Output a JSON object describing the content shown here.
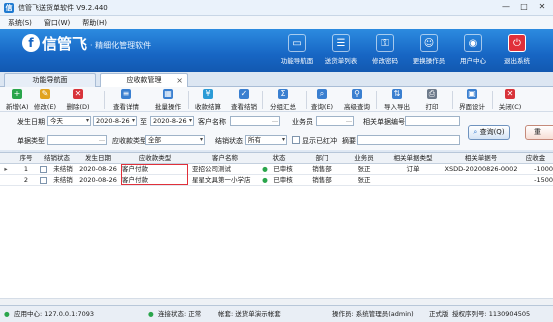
{
  "window": {
    "title": "信管飞送货单软件 V9.2.440",
    "min": "—",
    "max": "□",
    "close": "✕"
  },
  "menu": [
    {
      "label": "系统(S)"
    },
    {
      "label": "窗口(W)"
    },
    {
      "label": "帮助(H)"
    }
  ],
  "brand": {
    "logo_glyph": "f",
    "name": "信管飞",
    "slogan": "· 精细化管理软件"
  },
  "nav": [
    {
      "label": "功能导航面",
      "icon": "monitor-icon"
    },
    {
      "label": "送货单列表",
      "icon": "list-icon"
    },
    {
      "label": "修改密码",
      "icon": "key-icon"
    },
    {
      "label": "更换操作员",
      "icon": "user-icon"
    },
    {
      "label": "用户中心",
      "icon": "user-center-icon"
    },
    {
      "label": "退出系统",
      "icon": "power-icon"
    }
  ],
  "tabs": [
    {
      "label": "功能导航面"
    },
    {
      "label": "应收款管理",
      "close": "×"
    }
  ],
  "toolbar": [
    {
      "label": "新增(A)",
      "icon": "add-icon",
      "color": "#2aa54b",
      "glyph": "+"
    },
    {
      "label": "修改(E)",
      "icon": "edit-icon",
      "color": "#e1a320",
      "glyph": "✎"
    },
    {
      "label": "删除(D)",
      "icon": "delete-icon",
      "color": "#d8333a",
      "glyph": "✕"
    },
    {
      "label": "查看详情",
      "icon": "view-icon",
      "color": "#3a7fd0",
      "glyph": "≡"
    },
    {
      "label": "批量操作",
      "icon": "batch-icon",
      "color": "#3a7fd0",
      "glyph": "▦"
    },
    {
      "label": "收款结算",
      "icon": "settle-icon",
      "color": "#2b9bd6",
      "glyph": "¥"
    },
    {
      "label": "查看结销",
      "icon": "verify-icon",
      "color": "#3a7fd0",
      "glyph": "✓"
    },
    {
      "label": "分组汇总",
      "icon": "group-icon",
      "color": "#3a7fd0",
      "glyph": "Σ"
    },
    {
      "label": "查询(E)",
      "icon": "query-icon",
      "color": "#3a7fd0",
      "glyph": "⌕"
    },
    {
      "label": "高级查询",
      "icon": "advanced-query-icon",
      "color": "#3a7fd0",
      "glyph": "⚲"
    },
    {
      "label": "导入导出",
      "icon": "import-export-icon",
      "color": "#3a7fd0",
      "glyph": "⇅"
    },
    {
      "label": "打印",
      "icon": "print-icon",
      "color": "#6d7a8a",
      "glyph": "⎙"
    },
    {
      "label": "界面设计",
      "icon": "design-icon",
      "color": "#3a7fd0",
      "glyph": "▣"
    },
    {
      "label": "关闭(C)",
      "icon": "close-icon",
      "color": "#d8333a",
      "glyph": "✕"
    }
  ],
  "filters": {
    "date_label": "发生日期",
    "date_range": "今天",
    "date_from": "2020-8-26",
    "to": "至",
    "date_to": "2020-8-26",
    "customer_label": "客户名称",
    "clerk_label": "业务员",
    "related_label": "相关单据编号",
    "type_label": "单据类型",
    "receivable_type_label": "应收款类型",
    "receivable_type_value": "全部",
    "settle_label": "结销状态",
    "settle_value": "所有",
    "show_red": "显示已红冲",
    "summary_label": "摘要",
    "query_button": "查询(Q)",
    "reset_button": "重"
  },
  "table": {
    "columns": [
      "序号",
      "结销状态",
      "发生日期",
      "应收款类型",
      "客户名称",
      "状态",
      "部门",
      "业务员",
      "相关单据类型",
      "相关单据号",
      "应收金"
    ],
    "rows": [
      {
        "index": "1",
        "settle": "未结销",
        "date": "2020-08-26",
        "type": "客户付款",
        "customer": "亚招公司测试",
        "status": "已审核",
        "dept": "销售部",
        "clerk": "张正",
        "doc_type": "订单",
        "doc_no": "XSDD-20200826-0002",
        "amount": "-1000"
      },
      {
        "index": "2",
        "settle": "未结销",
        "date": "2020-08-26",
        "type": "客户付款",
        "customer": "星星文具第一小学店",
        "status": "已审核",
        "dept": "销售部",
        "clerk": "张正",
        "doc_type": "",
        "doc_no": "",
        "amount": "-1500"
      }
    ]
  },
  "status": {
    "app_center": "应用中心: 127.0.0.1:7093",
    "connection": "连接状态: 正常",
    "account": "帐套: 送货单演示帐套",
    "operator": "操作员: 系统管理员(admin)",
    "edition": "正式版",
    "serial": "授权序列号: 1130904505"
  },
  "colors": {
    "accent": "#1766c4",
    "highlight": "#e0303a",
    "ok": "#2aa54b"
  }
}
